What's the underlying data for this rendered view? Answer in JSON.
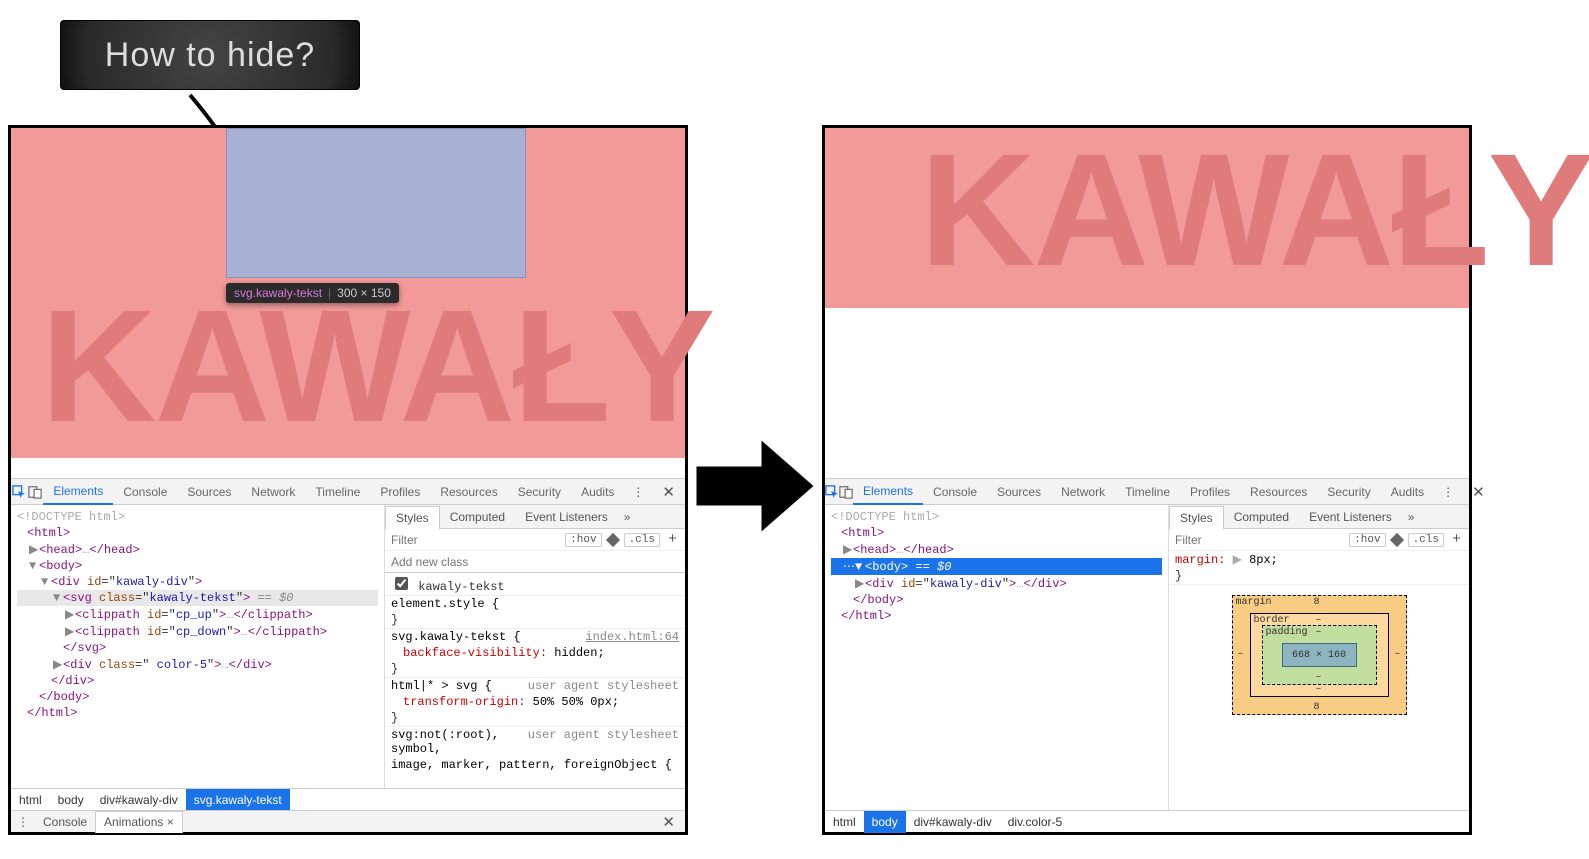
{
  "callout": {
    "text": "How to hide?"
  },
  "tooltip": {
    "selector": "svg.kawaly-tekst",
    "dims": "300 × 150"
  },
  "banner_text": "KAWAŁY",
  "devtools": {
    "tabs": [
      "Elements",
      "Console",
      "Sources",
      "Network",
      "Timeline",
      "Profiles",
      "Resources",
      "Security",
      "Audits"
    ],
    "active_tab": "Elements",
    "sub_tabs": [
      "Styles",
      "Computed",
      "Event Listeners"
    ],
    "sub_active": "Styles",
    "filter_placeholder": "Filter",
    "hov": ":hov",
    "cls": ".cls",
    "class_input_placeholder": "Add new class",
    "class_name": "kawaly-tekst",
    "rules_left": [
      {
        "sel": "element.style {",
        "props": [],
        "close": "}"
      },
      {
        "sel": "svg.kawaly-tekst {",
        "src": "index.html:64",
        "props": [
          {
            "p": "backface-visibility",
            "v": "hidden;"
          }
        ],
        "close": "}"
      },
      {
        "sel": "html|* > svg {",
        "uas": "user agent stylesheet",
        "props": [
          {
            "p": "transform-origin",
            "v": "50% 50% 0px;"
          }
        ],
        "close": "}"
      },
      {
        "sel_line": "svg:not(:root), symbol,",
        "uas": "user agent stylesheet"
      },
      {
        "sel_line": "image, marker, pattern, foreignObject {"
      }
    ],
    "rules_right": [
      {
        "sel_inline": "margin:",
        "tri": "▶",
        "val": "8px;",
        "close_next": "}"
      }
    ],
    "box_model": {
      "margin": "margin",
      "border": "border",
      "padding": "padding",
      "content": "668 × 160",
      "m_top": "8",
      "m_bottom": "8",
      "dash": "–"
    },
    "crumbsL": [
      "html",
      "body",
      "div#kawaly-div",
      "svg.kawaly-tekst"
    ],
    "crumbL_active": 3,
    "crumbsR": [
      "html",
      "body",
      "div#kawaly-div",
      "div.color-5"
    ],
    "crumbR_active": 1,
    "drawer_tabs": [
      "Console",
      "Animations ×"
    ]
  },
  "dom_left": {
    "doctype": "<!DOCTYPE html>",
    "lines": [
      {
        "ind": 0,
        "html": "<span class='op'>&lt;</span><span class='tag'>html</span><span class='op'>&gt;</span>"
      },
      {
        "ind": 1,
        "tri": "▶",
        "html": "<span class='op'>&lt;</span><span class='tag'>head</span><span class='op'>&gt;</span><span class='gray'>…</span><span class='op'>&lt;/</span><span class='tag'>head</span><span class='op'>&gt;</span>"
      },
      {
        "ind": 1,
        "tri": "▼",
        "html": "<span class='op'>&lt;</span><span class='tag'>body</span><span class='op'>&gt;</span>"
      },
      {
        "ind": 2,
        "tri": "▼",
        "html": "<span class='op'>&lt;</span><span class='tag'>div</span> <span class='attrn'>id</span>=\"<span class='attrv'>kawaly-div</span>\"<span class='op'>&gt;</span>"
      },
      {
        "sel": true,
        "ind": 3,
        "tri": "▼",
        "html": "<span class='op'>&lt;</span><span class='tag'>svg</span> <span class='attrn'>class</span>=\"<span class='attrv'>kawaly-tekst</span>\"<span class='op'>&gt;</span> <span class='eq0'>== $0</span>"
      },
      {
        "ind": 4,
        "tri": "▶",
        "html": "<span class='op'>&lt;</span><span class='tag'>clippath</span> <span class='attrn'>id</span>=\"<span class='attrv'>cp_up</span>\"<span class='op'>&gt;</span><span class='gray'>…</span><span class='op'>&lt;/</span><span class='tag'>clippath</span><span class='op'>&gt;</span>"
      },
      {
        "ind": 4,
        "tri": "▶",
        "html": "<span class='op'>&lt;</span><span class='tag'>clippath</span> <span class='attrn'>id</span>=\"<span class='attrv'>cp_down</span>\"<span class='op'>&gt;</span><span class='gray'>…</span><span class='op'>&lt;/</span><span class='tag'>clippath</span><span class='op'>&gt;</span>"
      },
      {
        "ind": 3,
        "html": "<span class='op'>&lt;/</span><span class='tag'>svg</span><span class='op'>&gt;</span>"
      },
      {
        "ind": 3,
        "tri": "▶",
        "html": "<span class='op'>&lt;</span><span class='tag'>div</span> <span class='attrn'>class</span>=\"<span class='attrv'> color-5</span>\"<span class='op'>&gt;</span><span class='gray'>…</span><span class='op'>&lt;/</span><span class='tag'>div</span><span class='op'>&gt;</span>"
      },
      {
        "ind": 2,
        "html": "<span class='op'>&lt;/</span><span class='tag'>div</span><span class='op'>&gt;</span>"
      },
      {
        "ind": 1,
        "html": "<span class='op'>&lt;/</span><span class='tag'>body</span><span class='op'>&gt;</span>"
      },
      {
        "ind": 0,
        "html": "<span class='op'>&lt;/</span><span class='tag'>html</span><span class='op'>&gt;</span>"
      }
    ]
  },
  "dom_right": {
    "doctype": "<!DOCTYPE html>",
    "lines": [
      {
        "ind": 0,
        "html": "<span class='op'>&lt;</span><span class='tag'>html</span><span class='op'>&gt;</span>"
      },
      {
        "ind": 1,
        "tri": "▶",
        "html": "<span class='op'>&lt;</span><span class='tag'>head</span><span class='op'>&gt;</span><span class='gray'>…</span><span class='op'>&lt;/</span><span class='tag'>head</span><span class='op'>&gt;</span>"
      },
      {
        "selBlue": true,
        "ind": 1,
        "tri": "▼",
        "pre": "⋯",
        "html": "<span class='op'>&lt;</span><span class='tag'>body</span><span class='op'>&gt;</span> <span class='eq0'>== $0</span>"
      },
      {
        "ind": 2,
        "tri": "▶",
        "html": "<span class='op'>&lt;</span><span class='tag'>div</span> <span class='attrn'>id</span>=\"<span class='attrv'>kawaly-div</span>\"<span class='op'>&gt;</span><span class='gray'>…</span><span class='op'>&lt;/</span><span class='tag'>div</span><span class='op'>&gt;</span>"
      },
      {
        "ind": 1,
        "html": "<span class='op'>&lt;/</span><span class='tag'>body</span><span class='op'>&gt;</span>"
      },
      {
        "ind": 0,
        "html": "<span class='op'>&lt;/</span><span class='tag'>html</span><span class='op'>&gt;</span>"
      }
    ]
  }
}
